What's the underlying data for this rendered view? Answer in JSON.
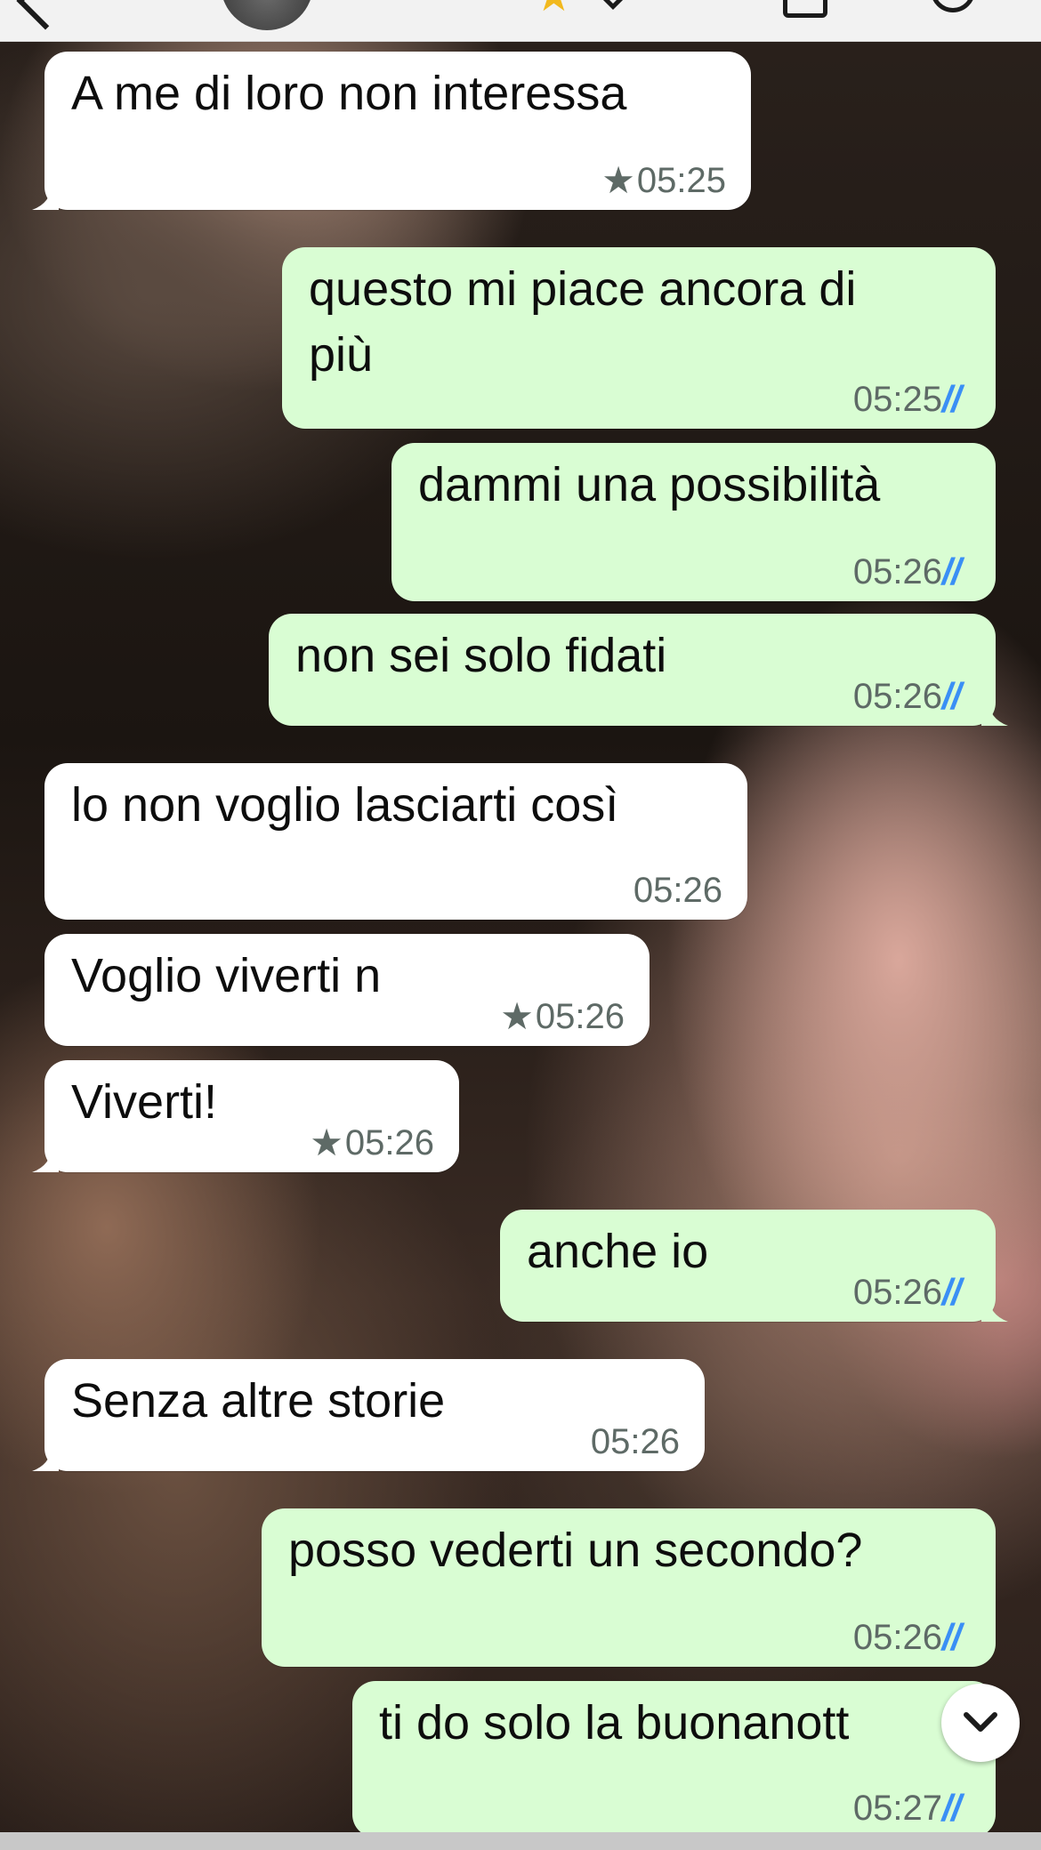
{
  "header": {
    "avatar_alt": "contact-avatar"
  },
  "colors": {
    "incoming_bubble": "#ffffff",
    "outgoing_bubble": "#d9fdd3",
    "read_receipt": "#3a8ff5",
    "meta_text": "#5e6a66",
    "starred_header": "#f2b91e"
  },
  "messages": [
    {
      "dir": "in",
      "text": "A me di loro non interessa",
      "time": "05:25",
      "starred": true
    },
    {
      "dir": "out",
      "line1": "questo mi piace ancora di",
      "line2": "più",
      "time": "05:25",
      "status": "read"
    },
    {
      "dir": "out",
      "text": "dammi una possibilità",
      "time": "05:26",
      "status": "read"
    },
    {
      "dir": "out",
      "text": "non sei solo fidati",
      "time": "05:26",
      "status": "read"
    },
    {
      "dir": "in",
      "text": "lo non voglio lasciarti così",
      "time": "05:26",
      "starred": false
    },
    {
      "dir": "in",
      "text": "Voglio viverti n",
      "time": "05:26",
      "starred": true
    },
    {
      "dir": "in",
      "text": "Viverti!",
      "time": "05:26",
      "starred": true
    },
    {
      "dir": "out",
      "text": "anche io",
      "time": "05:26",
      "status": "read"
    },
    {
      "dir": "in",
      "text": "Senza altre storie",
      "time": "05:26",
      "starred": false
    },
    {
      "dir": "out",
      "text": "posso vederti un secondo?",
      "time": "05:26",
      "status": "read"
    },
    {
      "dir": "out",
      "text": "ti do solo la buonanott",
      "time": "05:27",
      "status": "read"
    }
  ],
  "scroll_to_bottom": {
    "icon": "chevron-down-icon"
  }
}
